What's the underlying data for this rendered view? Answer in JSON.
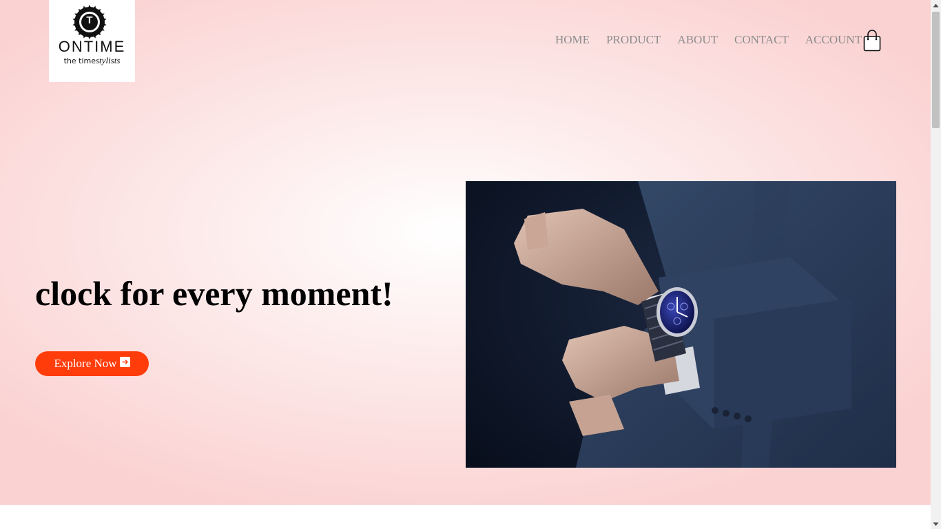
{
  "brand": {
    "name": "ONTIME",
    "tagline_prefix": "the time",
    "tagline_italic": "stylists",
    "logo_letter": "T"
  },
  "nav": {
    "items": [
      "HOME",
      "PRODUCT",
      "ABOUT",
      "CONTACT",
      "ACCOUNT"
    ],
    "cart_icon": "shopping-bag-icon"
  },
  "hero": {
    "headline": "clock for every moment!",
    "cta_label": "Explore Now",
    "cta_icon": "arrow-right-icon",
    "image_subject": "man-in-suit-adjusting-wristwatch"
  },
  "colors": {
    "accent": "#ff3c0a",
    "nav_text": "#8c8c8c",
    "hero_bg_edge": "#fbd2d2",
    "hero_bg_center": "#ffffff"
  }
}
